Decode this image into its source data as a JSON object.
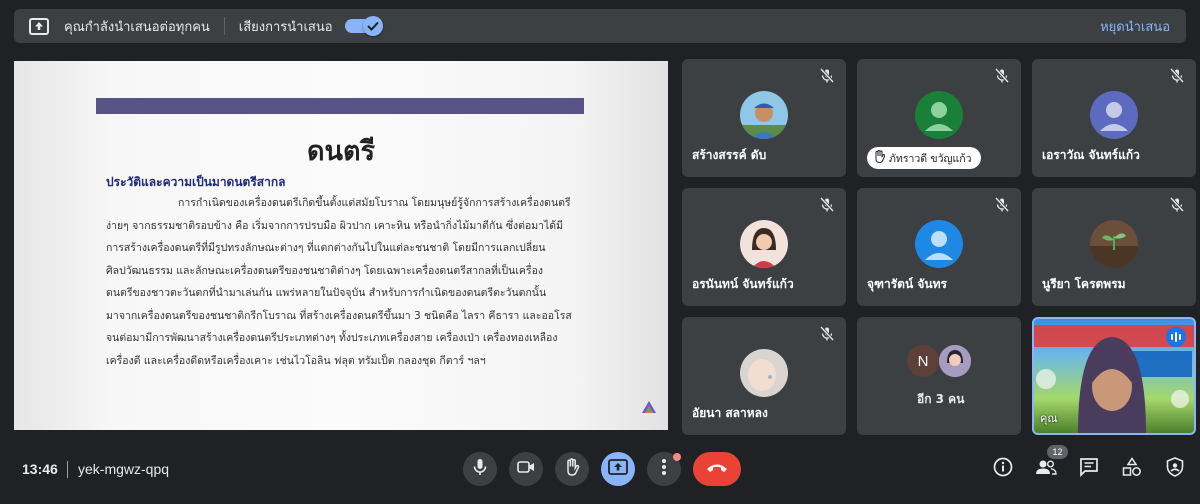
{
  "presenting_bar": {
    "status_text": "คุณกำลังนำเสนอต่อทุกคน",
    "audio_label": "เสียงการนำเสนอ",
    "audio_enabled": true,
    "stop_label": "หยุดนำเสนอ"
  },
  "slide": {
    "title": "ดนตรี",
    "heading": "ประวัติและความเป็นมาดนตรีสากล",
    "lines": [
      "การกำเนิดของเครื่องดนตรีเกิดขึ้นตั้งแต่สมัยโบราณ โดยมนุษย์รู้จักการสร้างเครื่องดนตรี",
      "ง่ายๆ จากธรรมชาติรอบข้าง คือ เริ่มจากการปรบมือ ผิวปาก เคาะหิน หรือนำกิ่งไม้มาตีกัน ซึ่งต่อมาได้มี",
      "การสร้างเครื่องดนตรีที่มีรูปทรงลักษณะต่างๆ ที่แตกต่างกันไปในแต่ละชนชาติ โดยมีการแลกเปลี่ยน",
      "ศิลปวัฒนธรรม และลักษณะเครื่องดนตรีของชนชาติต่างๆ โดยเฉพาะเครื่องดนตรีสากลที่เป็นเครื่อง",
      "ดนตรีของชาวตะวันตกที่นำมาเล่นกัน แพร่หลายในปัจจุบัน สำหรับการกำเนิดของดนตรีตะวันตกนั้น",
      "มาจากเครื่องดนตรีของชนชาติกรีกโบราณ ที่สร้างเครื่องดนตรีขึ้นมา 3 ชนิดคือ ไลรา คีธารา และออโรส",
      "จนต่อมามีการพัฒนาสร้างเครื่องดนตรีประเภทต่างๆ ทั้งประเภทเครื่องสาย เครื่องเป่า เครื่องทองเหลือง",
      "เครื่องตี และเครื่องดีดหรือเครื่องเคาะ เช่นไวโอลิน ฟลุต ทรัมเป็ต กลองชุด กีตาร์ ฯลฯ"
    ]
  },
  "participants": [
    {
      "name": "สร้างสรรค์ ดับ",
      "muted": true
    },
    {
      "name": "ภัทราวดี ขวัญแก้ว",
      "muted": true,
      "hand_raised": true
    },
    {
      "name": "เอราวัณ จันทร์แก้ว",
      "muted": true
    },
    {
      "name": "อรนันทน์ จันทร์แก้ว",
      "muted": true
    },
    {
      "name": "จุฑารัตน์ จันทร",
      "muted": true
    },
    {
      "name": "นูรียา โครตพรม",
      "muted": true
    },
    {
      "name": "อัยนา สลาหลง",
      "muted": true
    }
  ],
  "more_tile": {
    "initial": "N",
    "label": "อีก 3 คน"
  },
  "self_tile": {
    "label": "คุณ",
    "speaking": true
  },
  "bottom": {
    "time": "13:46",
    "meeting_code": "yek-mgwz-qpq",
    "participant_count": "12"
  },
  "colors": {
    "background": "#202124",
    "tile": "#3c4043",
    "accent": "#8ab4f8",
    "hangup": "#ea4335",
    "slide_bar": "#585287"
  },
  "icons": [
    "present-screen-icon",
    "check-icon",
    "mic-off-icon",
    "hand-icon",
    "mic-icon",
    "camera-icon",
    "raise-hand-icon",
    "present-icon",
    "more-vert-icon",
    "call-end-icon",
    "info-icon",
    "people-icon",
    "chat-icon",
    "activities-icon",
    "host-controls-icon"
  ]
}
